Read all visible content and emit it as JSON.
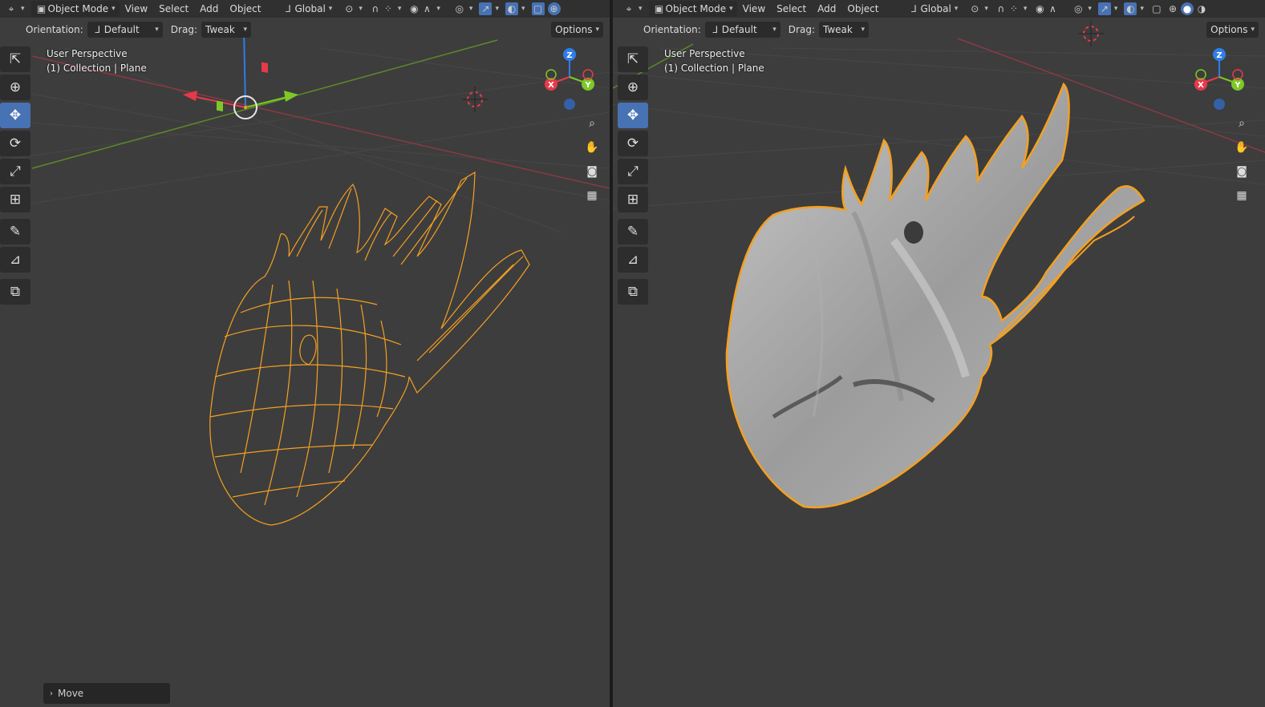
{
  "colors": {
    "selected_outline": "#f5a020",
    "active_tool": "#4772b3",
    "x_axis": "#e8394a",
    "y_axis": "#7dc925",
    "z_axis": "#2f7de8"
  },
  "viewports": [
    {
      "id": "left",
      "shading": "wireframe",
      "header": {
        "mode": "Object Mode",
        "menus": [
          "View",
          "Select",
          "Add",
          "Object"
        ],
        "transform_orientation": "Global"
      },
      "tool_header": {
        "orientation_label": "Orientation:",
        "orientation_value": "Default",
        "drag_label": "Drag:",
        "drag_value": "Tweak",
        "options": "Options"
      },
      "overlay": {
        "line1": "User Perspective",
        "line2": "(1) Collection | Plane"
      },
      "operator_panel": "Move"
    },
    {
      "id": "right",
      "shading": "solid",
      "header": {
        "mode": "Object Mode",
        "menus": [
          "View",
          "Select",
          "Add",
          "Object"
        ],
        "transform_orientation": "Global"
      },
      "tool_header": {
        "orientation_label": "Orientation:",
        "orientation_value": "Default",
        "drag_label": "Drag:",
        "drag_value": "Tweak",
        "options": "Options"
      },
      "overlay": {
        "line1": "User Perspective",
        "line2": "(1) Collection | Plane"
      }
    }
  ],
  "gizmo_labels": {
    "x": "X",
    "y": "Y",
    "z": "Z"
  },
  "toolbar_icons": [
    "select-box-icon",
    "cursor-icon",
    "move-icon",
    "rotate-icon",
    "scale-icon",
    "transform-icon",
    "annotate-icon",
    "measure-icon",
    "add-cube-icon"
  ],
  "nav_icons": [
    "zoom-icon",
    "pan-hand-icon",
    "camera-icon",
    "ortho-grid-icon"
  ]
}
